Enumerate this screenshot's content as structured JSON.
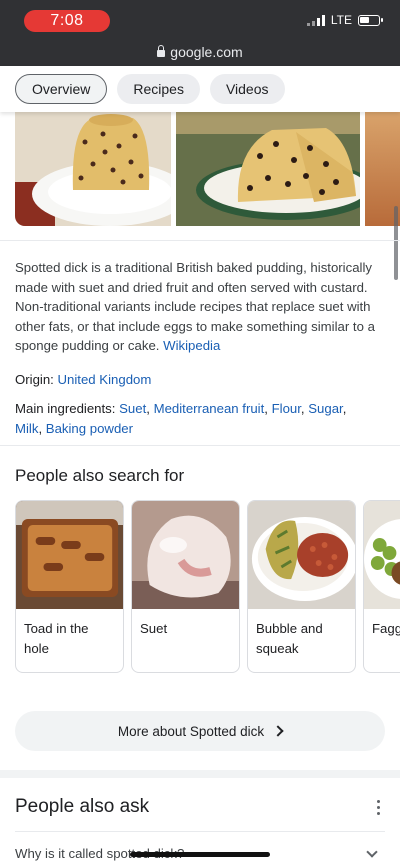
{
  "status_bar": {
    "time": "7:08",
    "network": "LTE"
  },
  "address_bar": {
    "url": "google.com"
  },
  "tabs": [
    {
      "label": "Overview",
      "active": true
    },
    {
      "label": "Recipes",
      "active": false
    },
    {
      "label": "Videos",
      "active": false
    }
  ],
  "description": {
    "text": "Spotted dick is a traditional British baked pudding, historically made with suet and dried fruit and often served with custard. Non-traditional variants include recipes that replace suet with other fats, or that include eggs to make something similar to a sponge pudding or cake.",
    "source": "Wikipedia"
  },
  "facts": {
    "origin_label": "Origin:",
    "origin_value": "United Kingdom",
    "ingredients_label": "Main ingredients:",
    "ingredients": [
      "Suet",
      "Mediterranean fruit",
      "Flour",
      "Sugar",
      "Milk",
      "Baking powder"
    ]
  },
  "people_also_search": {
    "title": "People also search for",
    "items": [
      {
        "label": "Toad in the hole"
      },
      {
        "label": "Suet"
      },
      {
        "label": "Bubble and squeak"
      },
      {
        "label": "Fagg"
      }
    ]
  },
  "more_about": {
    "label": "More about Spotted dick"
  },
  "people_also_ask": {
    "title": "People also ask",
    "questions": [
      "Why is it called spotted dick?"
    ]
  },
  "colors": {
    "link": "#1a5fb4",
    "status_bar_bg": "#303134",
    "time_pill": "#e53935"
  }
}
